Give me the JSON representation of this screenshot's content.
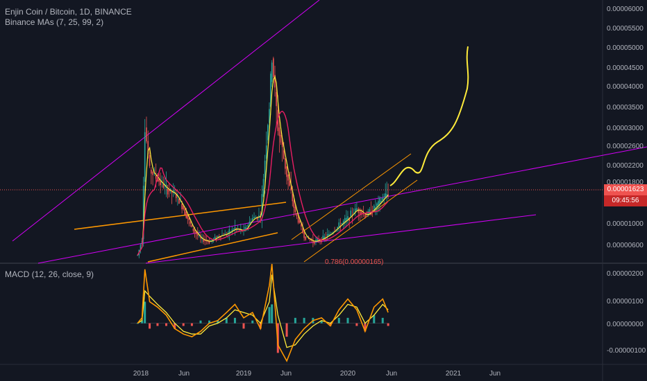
{
  "header": {
    "symbol_line": "Enjin Coin / Bitcoin, 1D, BINANCE",
    "ma_line": "Binance MAs (7, 25, 99, 2)",
    "macd_line": "MACD (12, 26, close, 9)"
  },
  "price_axis": {
    "labels": [
      "0.00006000",
      "0.00005500",
      "0.00005000",
      "0.00004500",
      "0.00004000",
      "0.00003500",
      "0.00003000",
      "0.00002600",
      "0.00002200",
      "0.00001800",
      "0",
      "0.00001000",
      "0.00000600"
    ]
  },
  "current_price": {
    "value": "0.00001623",
    "countdown": "09:45:56"
  },
  "fib_label": "0.786(0.00000165)",
  "macd_axis": {
    "labels": [
      "0.00000200",
      "0.00000100",
      "0.00000000",
      "-0.00000100"
    ]
  },
  "time_axis": {
    "labels": [
      "2018",
      "Jun",
      "2019",
      "Jun",
      "2020",
      "Jun",
      "2021",
      "Jun"
    ]
  },
  "colors": {
    "background": "#131722",
    "candle_up": "#26a69a",
    "candle_down": "#ef5350",
    "ma_fast": "#ffeb3b",
    "ma_slow": "#e91e63",
    "trendline_magenta": "#d500f9",
    "channel_orange": "#ff9800",
    "projection_yellow": "#ffeb3b",
    "macd_line": "#ff9800",
    "signal_line": "#ffeb3b"
  },
  "chart_data": {
    "type": "line",
    "title": "Enjin Coin / Bitcoin, 1D, BINANCE",
    "xlabel": "",
    "ylabel": "",
    "x": [
      "2017-12-20",
      "2018-01-05",
      "2018-01-15",
      "2018-02-01",
      "2018-03-01",
      "2018-04-01",
      "2018-05-01",
      "2018-06-01",
      "2018-07-01",
      "2018-08-01",
      "2018-09-01",
      "2018-10-01",
      "2018-11-01",
      "2018-12-01",
      "2019-01-01",
      "2019-02-01",
      "2019-03-01",
      "2019-04-01",
      "2019-04-10",
      "2019-05-01",
      "2019-06-01",
      "2019-07-01",
      "2019-08-01",
      "2019-09-01",
      "2019-10-01",
      "2019-11-01",
      "2019-12-01",
      "2020-01-01",
      "2020-02-01",
      "2020-03-01",
      "2020-04-01",
      "2020-05-01",
      "2020-05-20"
    ],
    "series": [
      {
        "values": [
          4e-06,
          7e-06,
          3e-05,
          2.1e-05,
          1.9e-05,
          1.7e-05,
          1.6e-05,
          1.3e-05,
          9e-06,
          7e-06,
          6.5e-06,
          7.5e-06,
          8e-06,
          9e-06,
          8.5e-06,
          1.1e-05,
          1.15e-05,
          3.5e-05,
          4.7e-05,
          3e-05,
          2e-05,
          1.2e-05,
          7.5e-06,
          6.5e-06,
          7e-06,
          8e-06,
          9.5e-06,
          1.1e-05,
          1.3e-05,
          1.15e-05,
          1.3e-05,
          1.5e-05,
          1.623e-05
        ]
      }
    ],
    "ylim": [
      3.5e-06,
      6.15e-05
    ],
    "macd": {
      "ylim": [
        -1.5e-06,
        2.2e-06
      ],
      "macd_values": [
        0,
        2e-07,
        2e-06,
        8e-07,
        6e-07,
        3e-07,
        -2e-07,
        -4e-07,
        -5e-07,
        -3e-07,
        0,
        1e-07,
        4e-07,
        7e-07,
        2e-07,
        4e-07,
        -2e-07,
        1.4e-06,
        2.5e-06,
        -8e-07,
        -1.4e-06,
        -6e-07,
        -2e-07,
        1e-07,
        2e-07,
        -1e-07,
        5e-07,
        9e-07,
        5e-07,
        -3e-07,
        6e-07,
        9e-07,
        4e-07
      ],
      "signal_values": [
        0,
        1e-07,
        1.2e-06,
        1e-06,
        7e-07,
        4e-07,
        0,
        -3e-07,
        -4e-07,
        -4e-07,
        -1e-07,
        0,
        2e-07,
        5e-07,
        4e-07,
        3e-07,
        0,
        8e-07,
        1.8e-06,
        3e-07,
        -9e-07,
        -8e-07,
        -4e-07,
        -1e-07,
        1e-07,
        0,
        3e-07,
        7e-07,
        6e-07,
        0,
        3e-07,
        7e-07,
        5e-07
      ]
    }
  }
}
